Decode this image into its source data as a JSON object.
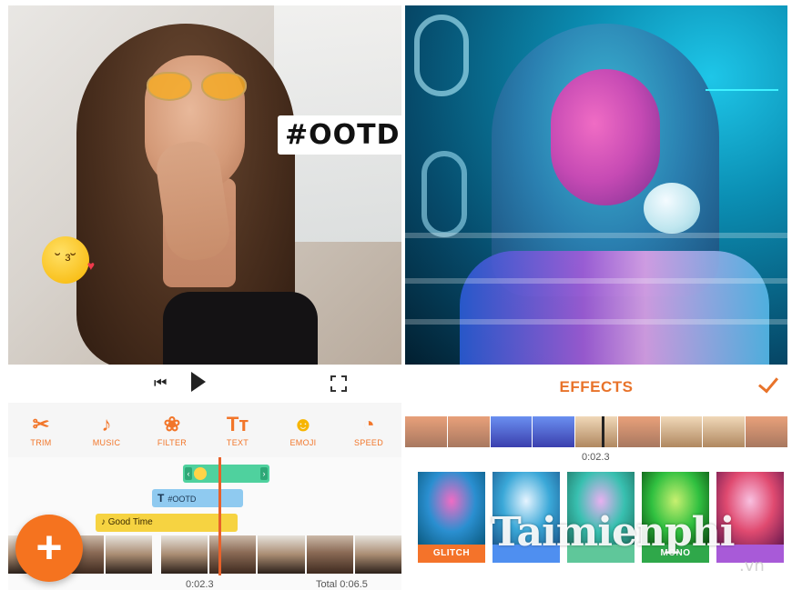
{
  "left_panel": {
    "stickers": {
      "hashtag": "#OOTD"
    },
    "toolbar": [
      {
        "label": "TRIM",
        "icon": "scissors-icon",
        "glyph": "✂"
      },
      {
        "label": "MUSIC",
        "icon": "music-note-icon",
        "glyph": "♪"
      },
      {
        "label": "FILTER",
        "icon": "filter-circles-icon",
        "glyph": "❀"
      },
      {
        "label": "TEXT",
        "icon": "text-icon",
        "glyph": "Tт"
      },
      {
        "label": "EMOJI",
        "icon": "emoji-icon",
        "glyph": "☻"
      },
      {
        "label": "SPEED",
        "icon": "speedometer-icon",
        "glyph": "◔"
      }
    ],
    "tracks": {
      "text_label": "#OOTD",
      "music_label": "Good Time"
    },
    "current_time": "0:02.3",
    "total_time": "Total 0:06.5",
    "fab_label": "+"
  },
  "right_panel": {
    "title": "EFFECTS",
    "current_time": "0:02.3",
    "effects": [
      {
        "name": "GLITCH",
        "color": "#f4732a"
      },
      {
        "name": "",
        "color": "#4f8ff0"
      },
      {
        "name": "",
        "color": "#5fc79a"
      },
      {
        "name": "MONO",
        "color": "#2fa84a"
      },
      {
        "name": "",
        "color": "#a85ad8"
      }
    ]
  },
  "watermark": {
    "text": "Taimienphi",
    "suffix": ".vn"
  },
  "colors": {
    "accent": "#f2762a",
    "music_track": "#f6d341",
    "text_track": "#8fcaf0",
    "emoji_track": "#4fd19e"
  }
}
